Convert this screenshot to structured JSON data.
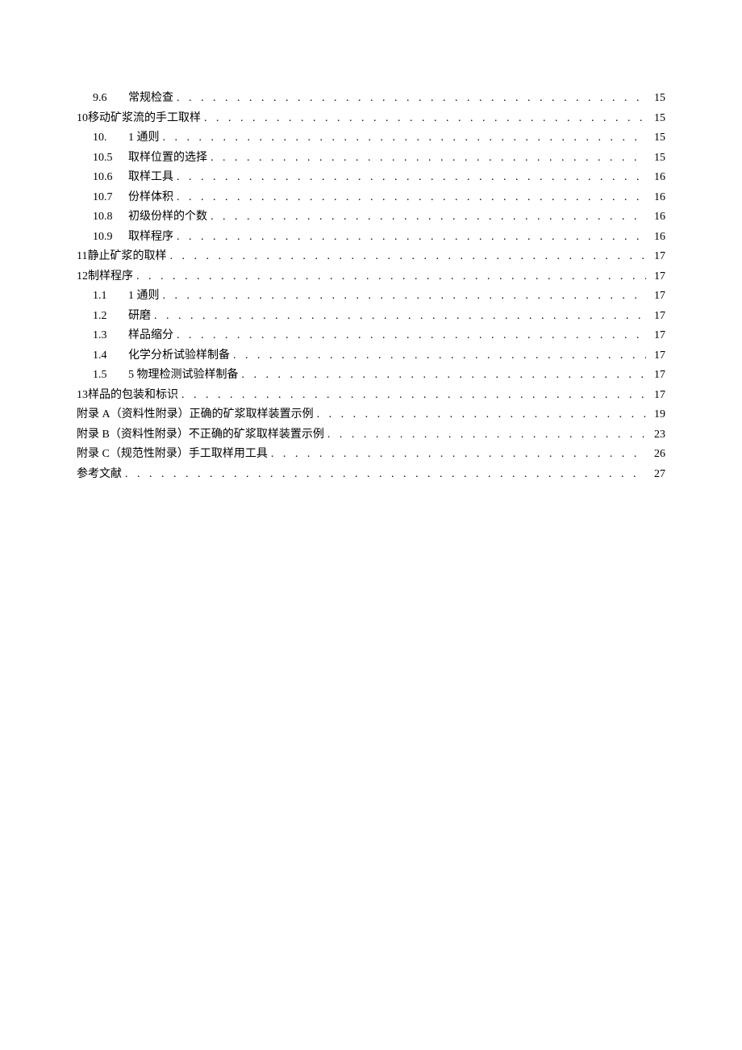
{
  "toc": {
    "entries": [
      {
        "level": 2,
        "num": "9.6",
        "numClass": "wide",
        "title": "常规检查",
        "page": "15"
      },
      {
        "level": 1,
        "num": "10",
        "numClass": "",
        "title": "移动矿浆流的手工取样",
        "page": "15"
      },
      {
        "level": 2,
        "num": "10.",
        "numClass": "wide",
        "title": "1 通则",
        "page": "15"
      },
      {
        "level": 2,
        "num": "10.5",
        "numClass": "wide",
        "title": "取样位置的选择",
        "page": "15"
      },
      {
        "level": 2,
        "num": "10.6",
        "numClass": "wide",
        "title": "取样工具",
        "page": "16"
      },
      {
        "level": 2,
        "num": "10.7",
        "numClass": "wide",
        "title": "份样体积",
        "page": "16"
      },
      {
        "level": 2,
        "num": "10.8",
        "numClass": "wide",
        "title": "初级份样的个数",
        "page": "16"
      },
      {
        "level": 2,
        "num": "10.9",
        "numClass": "wide",
        "title": "取样程序",
        "page": "16"
      },
      {
        "level": 1,
        "num": "11",
        "numClass": "",
        "title": "静止矿浆的取样",
        "page": "17"
      },
      {
        "level": 1,
        "num": "12",
        "numClass": "",
        "title": "制样程序",
        "page": "17"
      },
      {
        "level": 2,
        "num": "1.1",
        "numClass": "wide",
        "title": "1 通则",
        "page": "17"
      },
      {
        "level": 2,
        "num": "1.2",
        "numClass": "wide",
        "title": "研磨",
        "page": "17"
      },
      {
        "level": 2,
        "num": "1.3",
        "numClass": "wide",
        "title": "样品缩分",
        "page": "17"
      },
      {
        "level": 2,
        "num": "1.4",
        "numClass": "wide",
        "title": "化学分析试验样制备",
        "page": "17"
      },
      {
        "level": 2,
        "num": "1.5",
        "numClass": "wide",
        "title": "5 物理检测试验样制备",
        "page": "17"
      },
      {
        "level": 1,
        "num": "13",
        "numClass": "",
        "title": "样品的包装和标识",
        "page": "17"
      },
      {
        "level": 1,
        "num": "",
        "numClass": "",
        "title": "附录 A（资料性附录）正确的矿浆取样装置示例",
        "page": "19"
      },
      {
        "level": 1,
        "num": "",
        "numClass": "",
        "title": "附录 B（资料性附录）不正确的矿浆取样装置示例",
        "page": "23"
      },
      {
        "level": 1,
        "num": "",
        "numClass": "",
        "title": "附录 C（规范性附录）手工取样用工具",
        "page": "26"
      },
      {
        "level": 1,
        "num": "",
        "numClass": "",
        "title": "参考文献",
        "page": "27"
      }
    ]
  }
}
